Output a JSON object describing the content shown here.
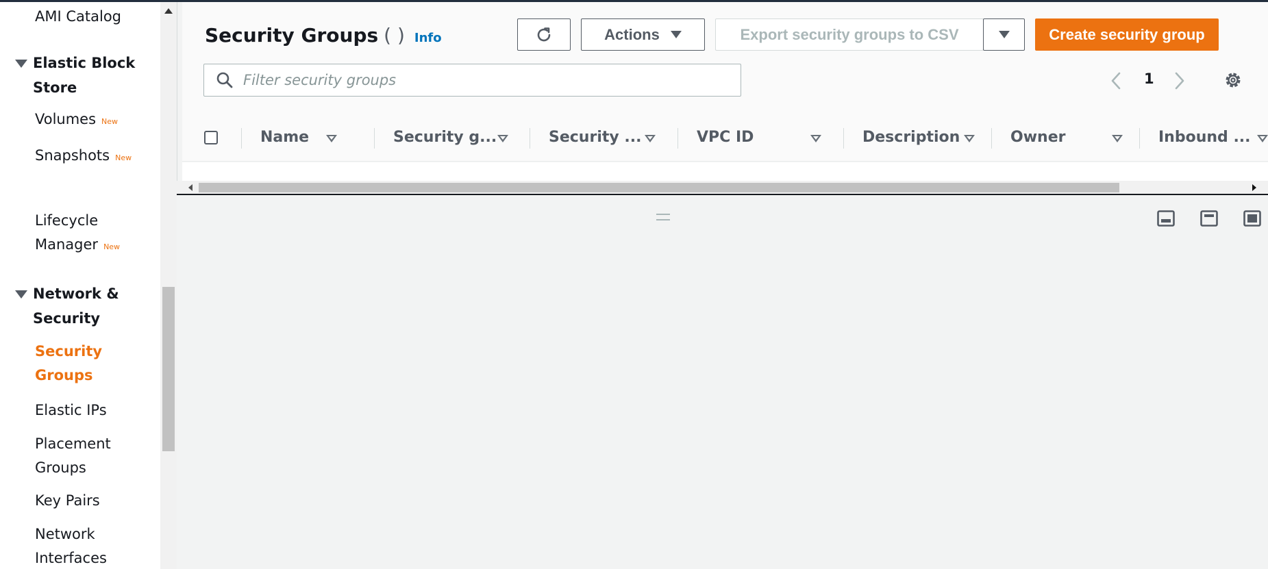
{
  "sidebar": {
    "ami_catalog": "AMI Catalog",
    "ebs_section": "Elastic Block Store",
    "volumes": "Volumes",
    "snapshots": "Snapshots",
    "lifecycle_manager_line1": "Lifecycle",
    "lifecycle_manager_line2": "Manager",
    "new_badge": "New",
    "network_section": "Network & Security",
    "security_groups_line1": "Security",
    "security_groups_line2": "Groups",
    "elastic_ips": "Elastic IPs",
    "placement_groups_line1": "Placement",
    "placement_groups_line2": "Groups",
    "key_pairs": "Key Pairs",
    "network_interfaces_line1": "Network",
    "network_interfaces_line2": "Interfaces"
  },
  "header": {
    "title": "Security Groups",
    "count": "( )",
    "info": "Info"
  },
  "toolbar": {
    "actions_label": "Actions",
    "export_label": "Export security groups to CSV",
    "create_label": "Create security group"
  },
  "search": {
    "placeholder": "Filter security groups",
    "value": ""
  },
  "pagination": {
    "current_page": "1"
  },
  "table": {
    "columns": [
      "Name",
      "Security g...",
      "Security ...",
      "VPC ID",
      "Description",
      "Owner",
      "Inbound ..."
    ]
  },
  "colors": {
    "accent": "#ec7211",
    "link": "#0073bb",
    "text": "#16191f"
  }
}
